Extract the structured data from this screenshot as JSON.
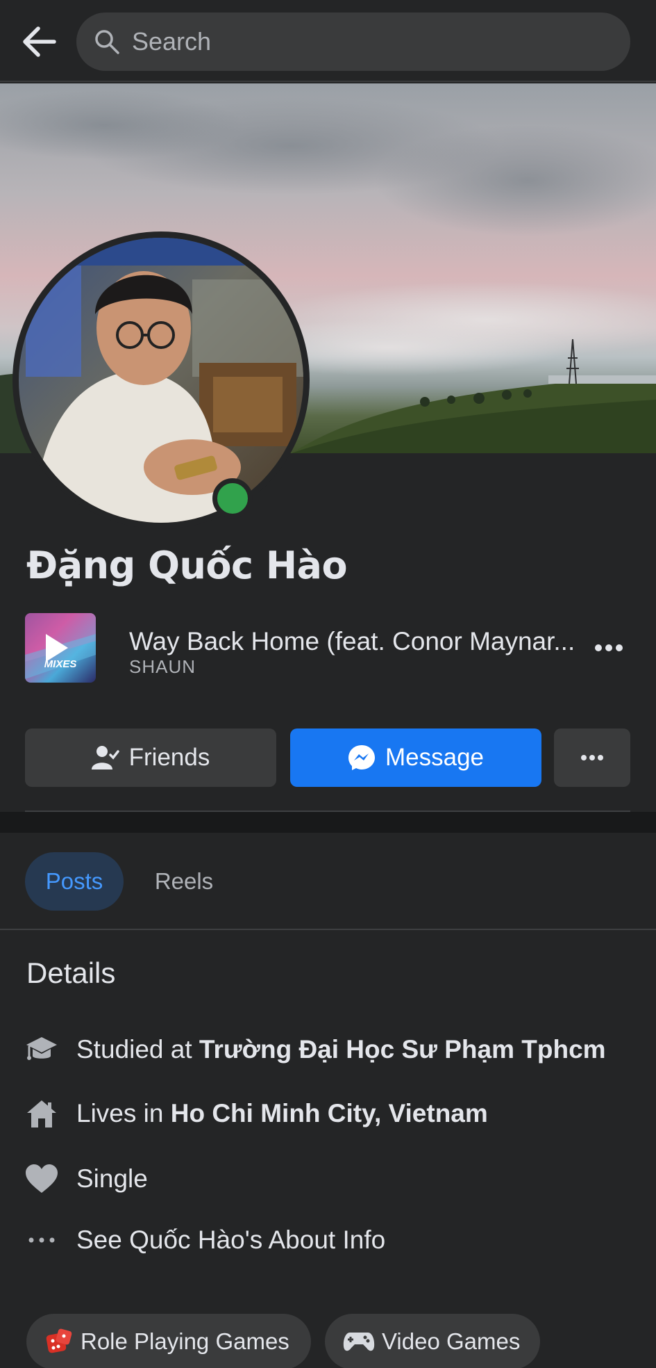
{
  "search": {
    "placeholder": "Search"
  },
  "profile": {
    "name": "Đặng Quốc Hào",
    "online": true
  },
  "song": {
    "title": "Way Back Home (feat. Conor Maynar...",
    "artist": "SHAUN",
    "art_text": "MIXES"
  },
  "actions": {
    "friends_label": "Friends",
    "message_label": "Message"
  },
  "tabs": [
    {
      "label": "Posts",
      "active": true
    },
    {
      "label": "Reels",
      "active": false
    }
  ],
  "details": {
    "title": "Details",
    "items": [
      {
        "icon": "graduation-cap-icon",
        "prefix": "Studied at ",
        "value": "Trường Đại Học Sư Phạm Tphcm"
      },
      {
        "icon": "home-icon",
        "prefix": "Lives in ",
        "value": "Ho Chi Minh City, Vietnam"
      },
      {
        "icon": "heart-icon",
        "prefix": "Single",
        "value": ""
      },
      {
        "icon": "more-horizontal-icon",
        "prefix": "See Quốc Hào's About Info",
        "value": ""
      }
    ]
  },
  "interests": [
    {
      "icon": "dice-icon",
      "label": "Role Playing Games"
    },
    {
      "icon": "gamepad-icon",
      "label": "Video Games"
    }
  ],
  "colors": {
    "background": "#242526",
    "accent": "#1877f2",
    "online": "#31a24c",
    "active_tab_bg": "#263951",
    "active_tab_text": "#4599ff"
  }
}
